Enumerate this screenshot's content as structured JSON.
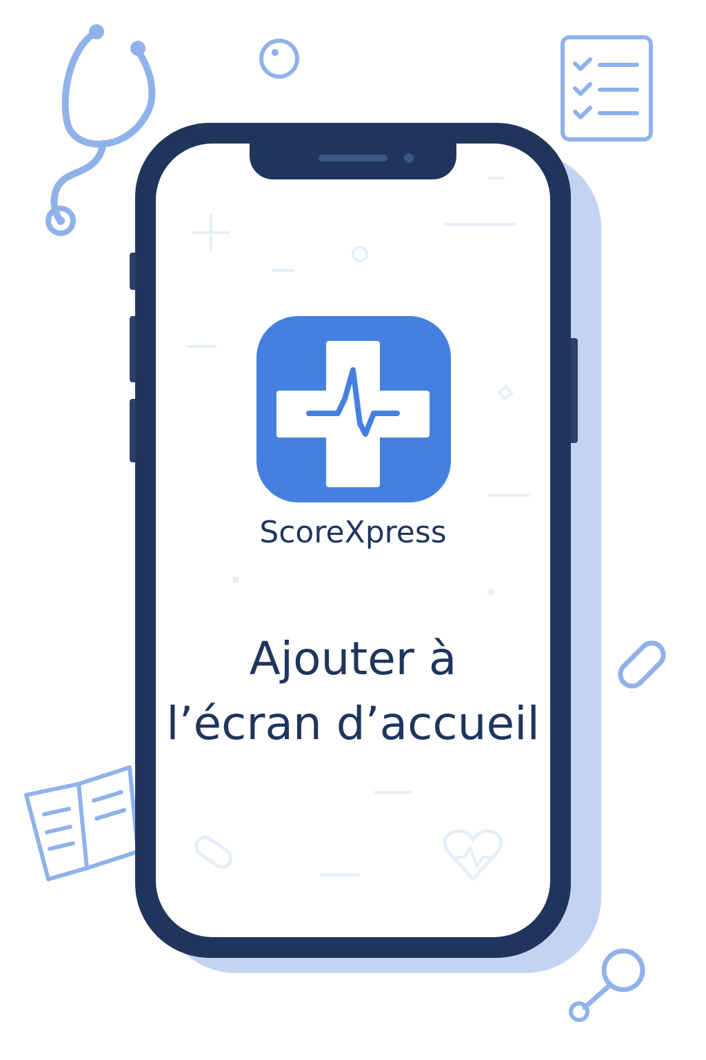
{
  "app": {
    "name": "ScoreXpress",
    "icon": "medical-cross-pulse-icon"
  },
  "headline": {
    "line1": "Ajouter à",
    "line2": "l’écran d’accueil"
  },
  "decorations": [
    "stethoscope-icon",
    "checklist-icon",
    "pill-icon",
    "open-book-icon",
    "heart-pulse-icon",
    "magnifier-icon"
  ],
  "colors": {
    "accent": "#4580e0",
    "phone_frame": "#1f355c",
    "text": "#1f355c",
    "decor_line": "#8fb2ea",
    "shadow": "#b9cdf1"
  }
}
